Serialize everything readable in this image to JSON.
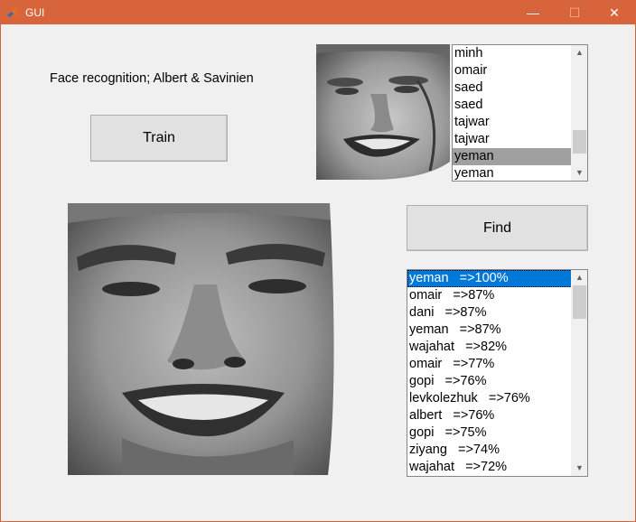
{
  "window": {
    "title": "GUI",
    "controls": {
      "minimize": "—",
      "maximize": "☐",
      "close": "✕"
    },
    "titlebar_color": "#d8643c"
  },
  "main": {
    "label": "Face recognition; Albert & Savinien",
    "train_button": "Train",
    "find_button": "Find"
  },
  "names_list": {
    "items": [
      "minh",
      "omair",
      "saed",
      "saed",
      "tajwar",
      "tajwar",
      "yeman",
      "yeman"
    ],
    "selected_index": 6
  },
  "results_list": {
    "items": [
      "yeman   =>100%",
      "omair   =>87%",
      "dani   =>87%",
      "yeman   =>87%",
      "wajahat   =>82%",
      "omair   =>77%",
      "gopi   =>76%",
      "levkolezhuk   =>76%",
      "albert   =>76%",
      "gopi   =>75%",
      "ziyang   =>74%",
      "wajahat   =>72%"
    ],
    "selected_index": 0,
    "selection_color": "#0078d7"
  },
  "icons": {
    "app": "matlab-icon",
    "scroll_up": "▲",
    "scroll_down": "▼"
  }
}
